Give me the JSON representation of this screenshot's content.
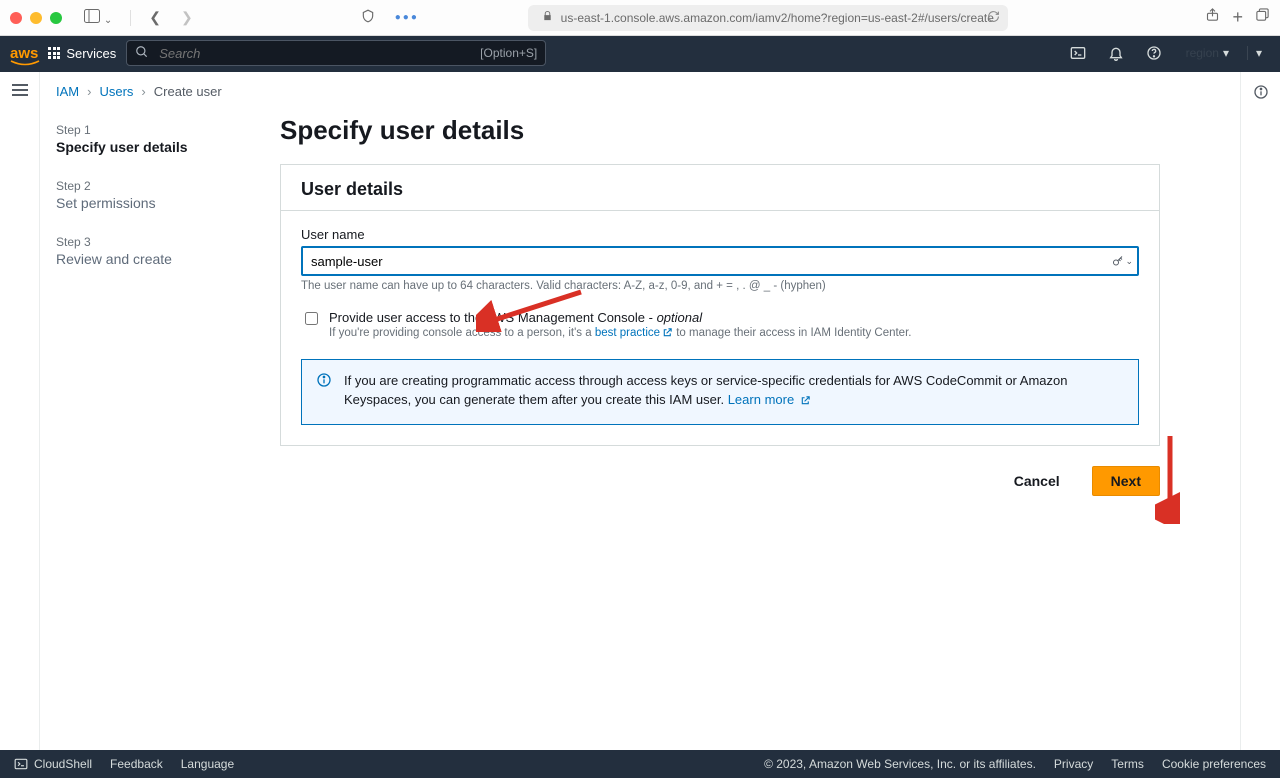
{
  "browser": {
    "url": "us-east-1.console.aws.amazon.com/iamv2/home?region=us-east-2#/users/create"
  },
  "nav": {
    "logo_text": "aws",
    "services_label": "Services",
    "search_placeholder": "Search",
    "search_hint": "[Option+S]"
  },
  "breadcrumbs": {
    "iam": "IAM",
    "users": "Users",
    "current": "Create user"
  },
  "wizard": {
    "steps": [
      {
        "num": "Step 1",
        "label": "Specify user details"
      },
      {
        "num": "Step 2",
        "label": "Set permissions"
      },
      {
        "num": "Step 3",
        "label": "Review and create"
      }
    ]
  },
  "page": {
    "title": "Specify user details",
    "card_title": "User details",
    "username_label": "User name",
    "username_value": "sample-user",
    "username_help": "The user name can have up to 64 characters. Valid characters: A-Z, a-z, 0-9, and + = , . @ _ - (hyphen)",
    "console_access_label_main": "Provide user access to the AWS Management Console - ",
    "console_access_optional": "optional",
    "console_access_sub_pre": "If you're providing console access to a person, it's a ",
    "console_access_sub_link": "best practice",
    "console_access_sub_post": " to manage their access in IAM Identity Center.",
    "info_text_pre": "If you are creating programmatic access through access keys or service-specific credentials for AWS CodeCommit or Amazon Keyspaces, you can generate them after you create this IAM user. ",
    "info_link": "Learn more"
  },
  "actions": {
    "cancel": "Cancel",
    "next": "Next"
  },
  "footer": {
    "cloudshell": "CloudShell",
    "feedback": "Feedback",
    "language": "Language",
    "copyright": "© 2023, Amazon Web Services, Inc. or its affiliates.",
    "privacy": "Privacy",
    "terms": "Terms",
    "cookies": "Cookie preferences"
  },
  "colors": {
    "accent": "#ff9900",
    "link": "#0073bb",
    "annotation_red": "#d93025"
  }
}
